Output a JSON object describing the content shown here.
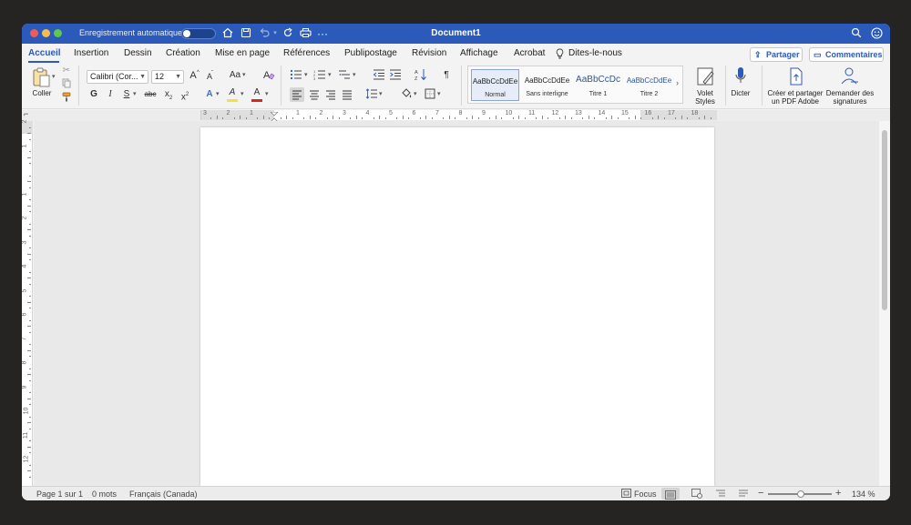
{
  "window": {
    "title": "Document1",
    "autosave_label": "Enregistrement automatique",
    "autosave_state": "Off",
    "accent_color": "#2b5aba"
  },
  "titlebar_icons": [
    "home-icon",
    "save-icon",
    "undo-icon",
    "redo-icon",
    "print-icon",
    "more-icon",
    "search-icon",
    "smiley-icon"
  ],
  "tabs": [
    {
      "label": "Accueil",
      "active": true
    },
    {
      "label": "Insertion"
    },
    {
      "label": "Dessin"
    },
    {
      "label": "Création"
    },
    {
      "label": "Mise en page"
    },
    {
      "label": "Références"
    },
    {
      "label": "Publipostage"
    },
    {
      "label": "Révision"
    },
    {
      "label": "Affichage"
    },
    {
      "label": "Acrobat"
    },
    {
      "label": "Dites-le-nous"
    }
  ],
  "actions": {
    "share": "Partager",
    "comments": "Commentaires"
  },
  "ribbon": {
    "paste_label": "Coller",
    "font_name": "Calibri (Cor...",
    "font_size": "12",
    "grow_font": "A",
    "shrink_font": "A",
    "change_case": "Aa",
    "bold": "G",
    "italic": "I",
    "underline": "S",
    "strikethrough": "abc",
    "subscript": "x",
    "superscript": "x",
    "text_effects": "A",
    "highlight": "A",
    "font_color": "A",
    "sort_icon": "sort-icon",
    "pilcrow": "¶",
    "styles": [
      {
        "sample": "AaBbCcDdEe",
        "name": "Normal",
        "selected": true
      },
      {
        "sample": "AaBbCcDdEe",
        "name": "Sans interligne"
      },
      {
        "sample": "AaBbCcDc",
        "name": "Titre 1"
      },
      {
        "sample": "AaBbCcDdEe",
        "name": "Titre 2"
      }
    ],
    "styles_pane": "Volet Styles",
    "dictate": "Dicter",
    "create_pdf": "Créer et partager un PDF Adobe",
    "request_signatures": "Demander des signatures"
  },
  "ruler": {
    "numbers": [
      "3",
      "2",
      "1",
      "",
      "1",
      "2",
      "3",
      "4",
      "5",
      "6",
      "7",
      "8",
      "9",
      "10",
      "11",
      "12",
      "13",
      "14",
      "15",
      "16",
      "17",
      "18"
    ]
  },
  "vruler_numbers": [
    "2",
    "1",
    "",
    "1",
    "2",
    "3",
    "4",
    "5",
    "6",
    "7",
    "8",
    "9",
    "10",
    "11",
    "12"
  ],
  "status": {
    "page": "Page 1 sur 1",
    "words": "0 mots",
    "language": "Français (Canada)",
    "focus": "Focus",
    "zoom": "134 %",
    "zoom_level": 0.52
  }
}
